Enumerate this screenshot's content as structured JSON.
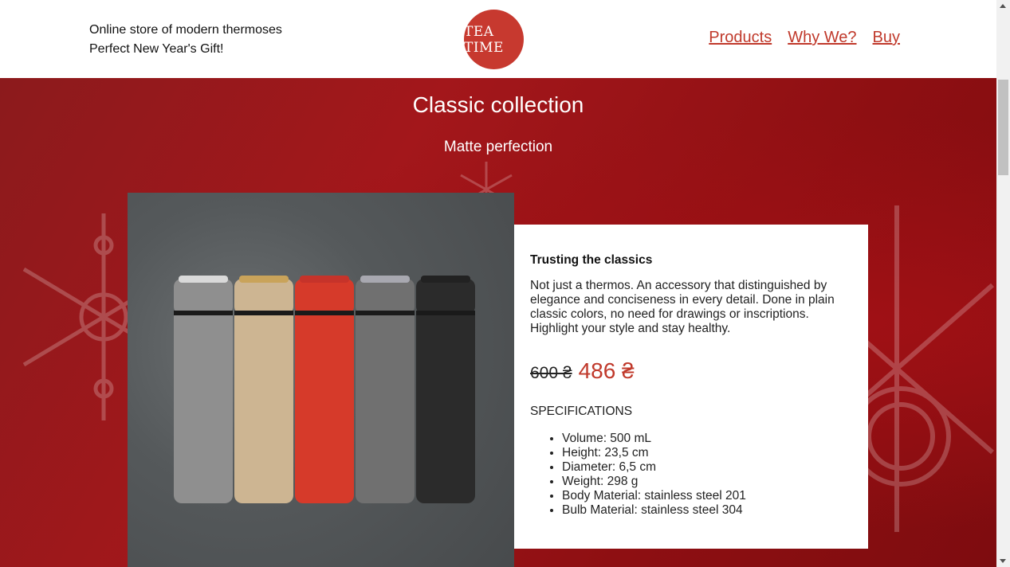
{
  "header": {
    "tagline_line1": "Online store of modern thermoses",
    "tagline_line2": "Perfect New Year's Gift!",
    "logo_text": "Tea time",
    "nav": [
      "Products",
      "Why We?",
      "Buy"
    ]
  },
  "hero": {
    "title": "Classic collection",
    "subtitle": "Matte perfection"
  },
  "product": {
    "heading": "Trusting the classics",
    "description": "Not just a thermos. An accessory that distinguished by elegance and conciseness in every detail. Done in plain classic colors, no need for drawings or inscriptions. Highlight your style and stay healthy.",
    "old_price": "600 ₴",
    "new_price": "486 ₴",
    "specs_title": "SPECIFICATIONS",
    "specs": [
      "Volume: 500 mL",
      "Height: 23,5 cm",
      "Diameter: 6,5 cm",
      "Weight: 298 g",
      "Body Material: stainless steel 201",
      "Bulb Material: stainless steel 304"
    ],
    "thermos_colors": [
      "#8f8f8f",
      "#cdb592",
      "#d63a2a",
      "#707070",
      "#2b2b2b"
    ]
  },
  "colors": {
    "accent": "#c0392b",
    "hero_bg": "#8c1a1c"
  }
}
